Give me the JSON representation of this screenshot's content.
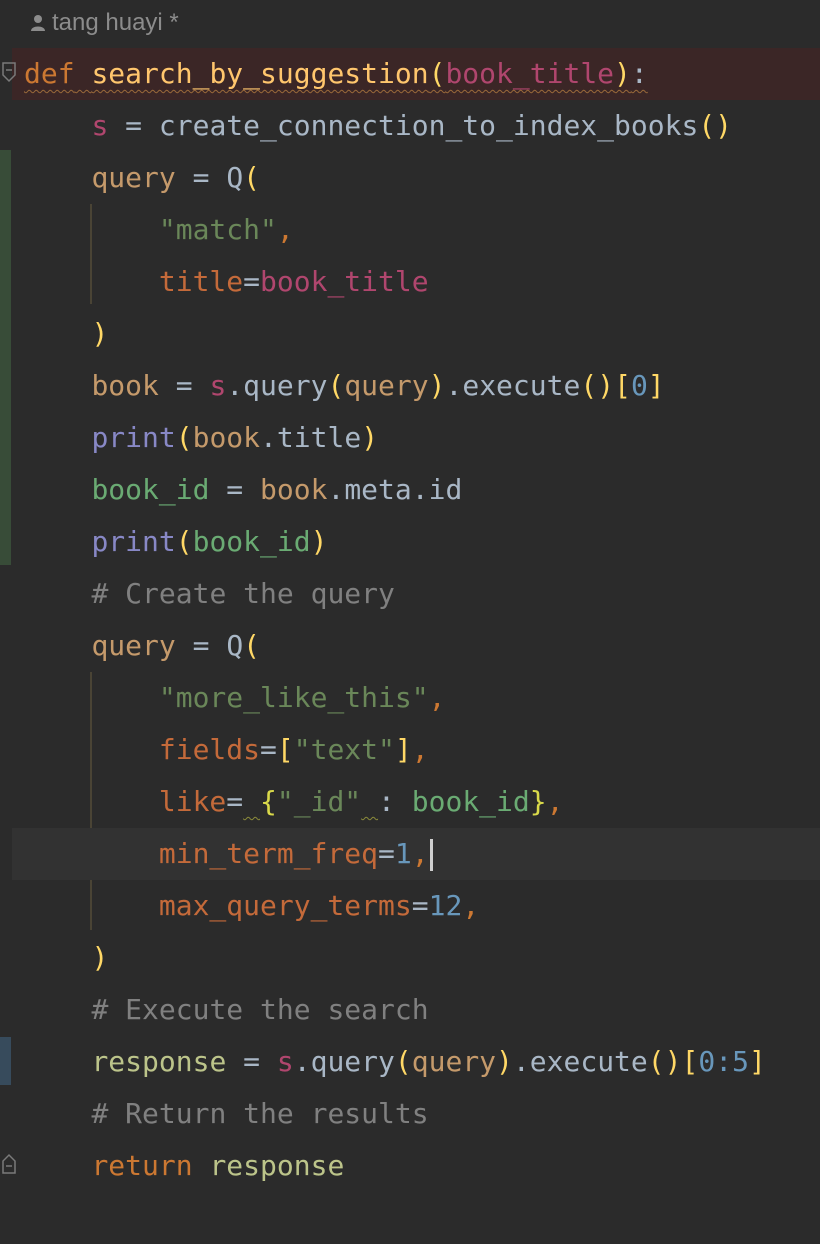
{
  "editor": {
    "author_label": "tang huayi *",
    "icons": {
      "author": "person-icon",
      "fold_open": "fold-collapse-icon",
      "fold_end": "fold-end-icon"
    },
    "colors": {
      "background": "#2b2b2b",
      "keyword": "#cc7832",
      "function": "#ffc66d",
      "string": "#6a8759",
      "number": "#6897bb",
      "comment": "#808080",
      "warning_line_bg": "#3b2626",
      "caret_line_bg": "#323232"
    },
    "lines": [
      {
        "tokens": [
          "def",
          " ",
          "search_by_suggestion",
          "(",
          "book_title",
          ")",
          ":"
        ]
      },
      {
        "tokens": [
          "    ",
          "s",
          " = ",
          "create_connection_to_index_books",
          "()"
        ]
      },
      {
        "tokens": [
          "    ",
          "query",
          " = ",
          "Q",
          "("
        ]
      },
      {
        "tokens": [
          "        ",
          "\"match\"",
          ","
        ]
      },
      {
        "tokens": [
          "        ",
          "title",
          "=",
          "book_title"
        ]
      },
      {
        "tokens": [
          "    ",
          ")"
        ]
      },
      {
        "tokens": [
          "    ",
          "book",
          " = ",
          "s",
          ".",
          "query",
          "(",
          "query",
          ")",
          ".",
          "execute",
          "()",
          "[",
          "0",
          "]"
        ]
      },
      {
        "tokens": [
          "    ",
          "print",
          "(",
          "book",
          ".",
          "title",
          ")"
        ]
      },
      {
        "tokens": [
          "    ",
          "book_id",
          " = ",
          "book",
          ".",
          "meta",
          ".",
          "id"
        ]
      },
      {
        "tokens": [
          "    ",
          "print",
          "(",
          "book_id",
          ")"
        ]
      },
      {
        "tokens": [
          "    ",
          "# Create the query"
        ]
      },
      {
        "tokens": [
          "    ",
          "query",
          " = ",
          "Q",
          "("
        ]
      },
      {
        "tokens": [
          "        ",
          "\"more_like_this\"",
          ","
        ]
      },
      {
        "tokens": [
          "        ",
          "fields",
          "=",
          "[",
          "\"text\"",
          "]",
          ","
        ]
      },
      {
        "tokens": [
          "        ",
          "like",
          "=",
          " ",
          "{",
          "\"_id\"",
          " ",
          ": ",
          "book_id",
          "}",
          ","
        ]
      },
      {
        "tokens": [
          "        ",
          "min_term_freq",
          "=",
          "1",
          ","
        ]
      },
      {
        "tokens": [
          "        ",
          "max_query_terms",
          "=",
          "12",
          ","
        ]
      },
      {
        "tokens": [
          "    ",
          ")"
        ]
      },
      {
        "tokens": [
          "    ",
          "# Execute the search"
        ]
      },
      {
        "tokens": [
          "    ",
          "response",
          " = ",
          "s",
          ".",
          "query",
          "(",
          "query",
          ")",
          ".",
          "execute",
          "()",
          "[",
          "0:5",
          "]"
        ]
      },
      {
        "tokens": [
          "    ",
          "# Return the results"
        ]
      },
      {
        "tokens": [
          "    ",
          "return",
          " ",
          "response"
        ]
      }
    ]
  }
}
